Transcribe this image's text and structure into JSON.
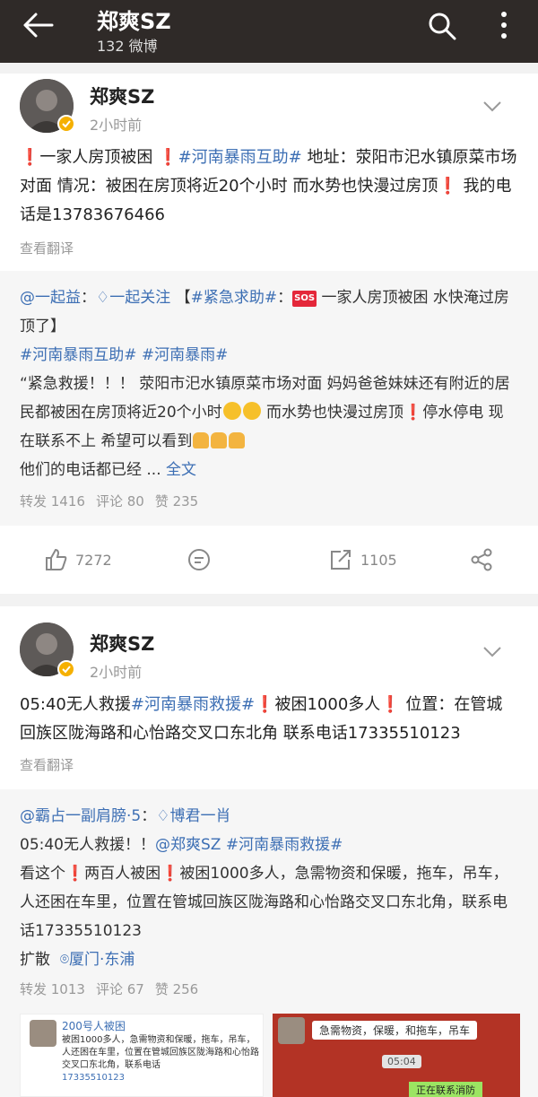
{
  "header": {
    "title": "郑爽SZ",
    "subtitle": "132 微博"
  },
  "posts": [
    {
      "author": "郑爽SZ",
      "time": "2小时前",
      "body": {
        "p1": "一家人房顶被困 ",
        "tag1": "#河南暴雨互助#",
        "p2": " 地址：荥阳市汜水镇原菜市场对面 情况：被困在房顶将近20个小时 而水势也快漫过房顶",
        "p3": " 我的电话是13783676466"
      },
      "translate": "查看翻译",
      "repost": {
        "user1": "@一起益",
        "sep1": "：",
        "user2": "一起关注",
        "tagopen": " 【",
        "tag1": "#紧急求助#",
        "sep2": "：",
        "sos": "SOS",
        "line1": " 一家人房顶被困 水快淹过房顶了】",
        "tag2": "#河南暴雨互助#",
        "tag3": " #河南暴雨#",
        "body": "“紧急救援！！！ 荥阳市汜水镇原菜市场对面 妈妈爸爸妹妹还有附近的居民都被困在房顶将近20个小时",
        "body2": " 而水势也快漫过房顶",
        "body3": "停水停电 现在联系不上 希望可以看到",
        "last": "他们的电话都已经 ... ",
        "more": "全文",
        "stats": {
          "repost": "转发 1416",
          "comment": "评论 80",
          "like": "赞 235"
        }
      },
      "actions": {
        "like": "7272",
        "repost": "1105"
      }
    },
    {
      "author": "郑爽SZ",
      "time": "2小时前",
      "body": {
        "p1": "05:40无人救援",
        "tag1": "#河南暴雨救援#",
        "p2": "被困1000多人",
        "p3": " 位置：在管城回族区陇海路和心怡路交叉口东北角 联系电话17335510123"
      },
      "translate": "查看翻译",
      "repost": {
        "user1": "@霸占一副肩膀·5",
        "sep1": "：",
        "user2": "博君一肖",
        "line1a": "05:40无人救援！！",
        "mention": "@郑爽SZ",
        "tag": " #河南暴雨救援#",
        "body_a": "看这个",
        "body_b": "两百人被困",
        "body_c": "被困1000多人，急需物资和保暖，拖车，吊车，人还困在车里，位置在管城回族区陇海路和心怡路交叉口东北角，联系电话17335510123",
        "spread": "扩散",
        "location": "厦门·东浦",
        "stats": {
          "repost": "转发 1013",
          "comment": "评论 67",
          "like": "赞 256"
        }
      },
      "thumbs": {
        "left_head": "200号人被困",
        "left_body": "被困1000多人，急需物资和保暖，拖车，吊车，人还困在车里，位置在管城回族区陇海路和心怡路交叉口东北角，联系电话",
        "left_phone": "17335510123",
        "right_bubble": "急需物资，保暖，和拖车，吊车",
        "right_time": "05:04",
        "right_green": "正在联系消防"
      }
    }
  ]
}
